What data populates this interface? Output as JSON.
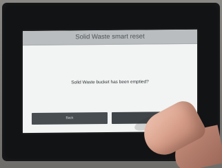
{
  "dialog": {
    "title": "Solid Waste smart reset",
    "message": "Solid Waste bucket has been emptied?",
    "buttons": [
      {
        "label": "Back"
      },
      {
        "label": ""
      }
    ]
  }
}
